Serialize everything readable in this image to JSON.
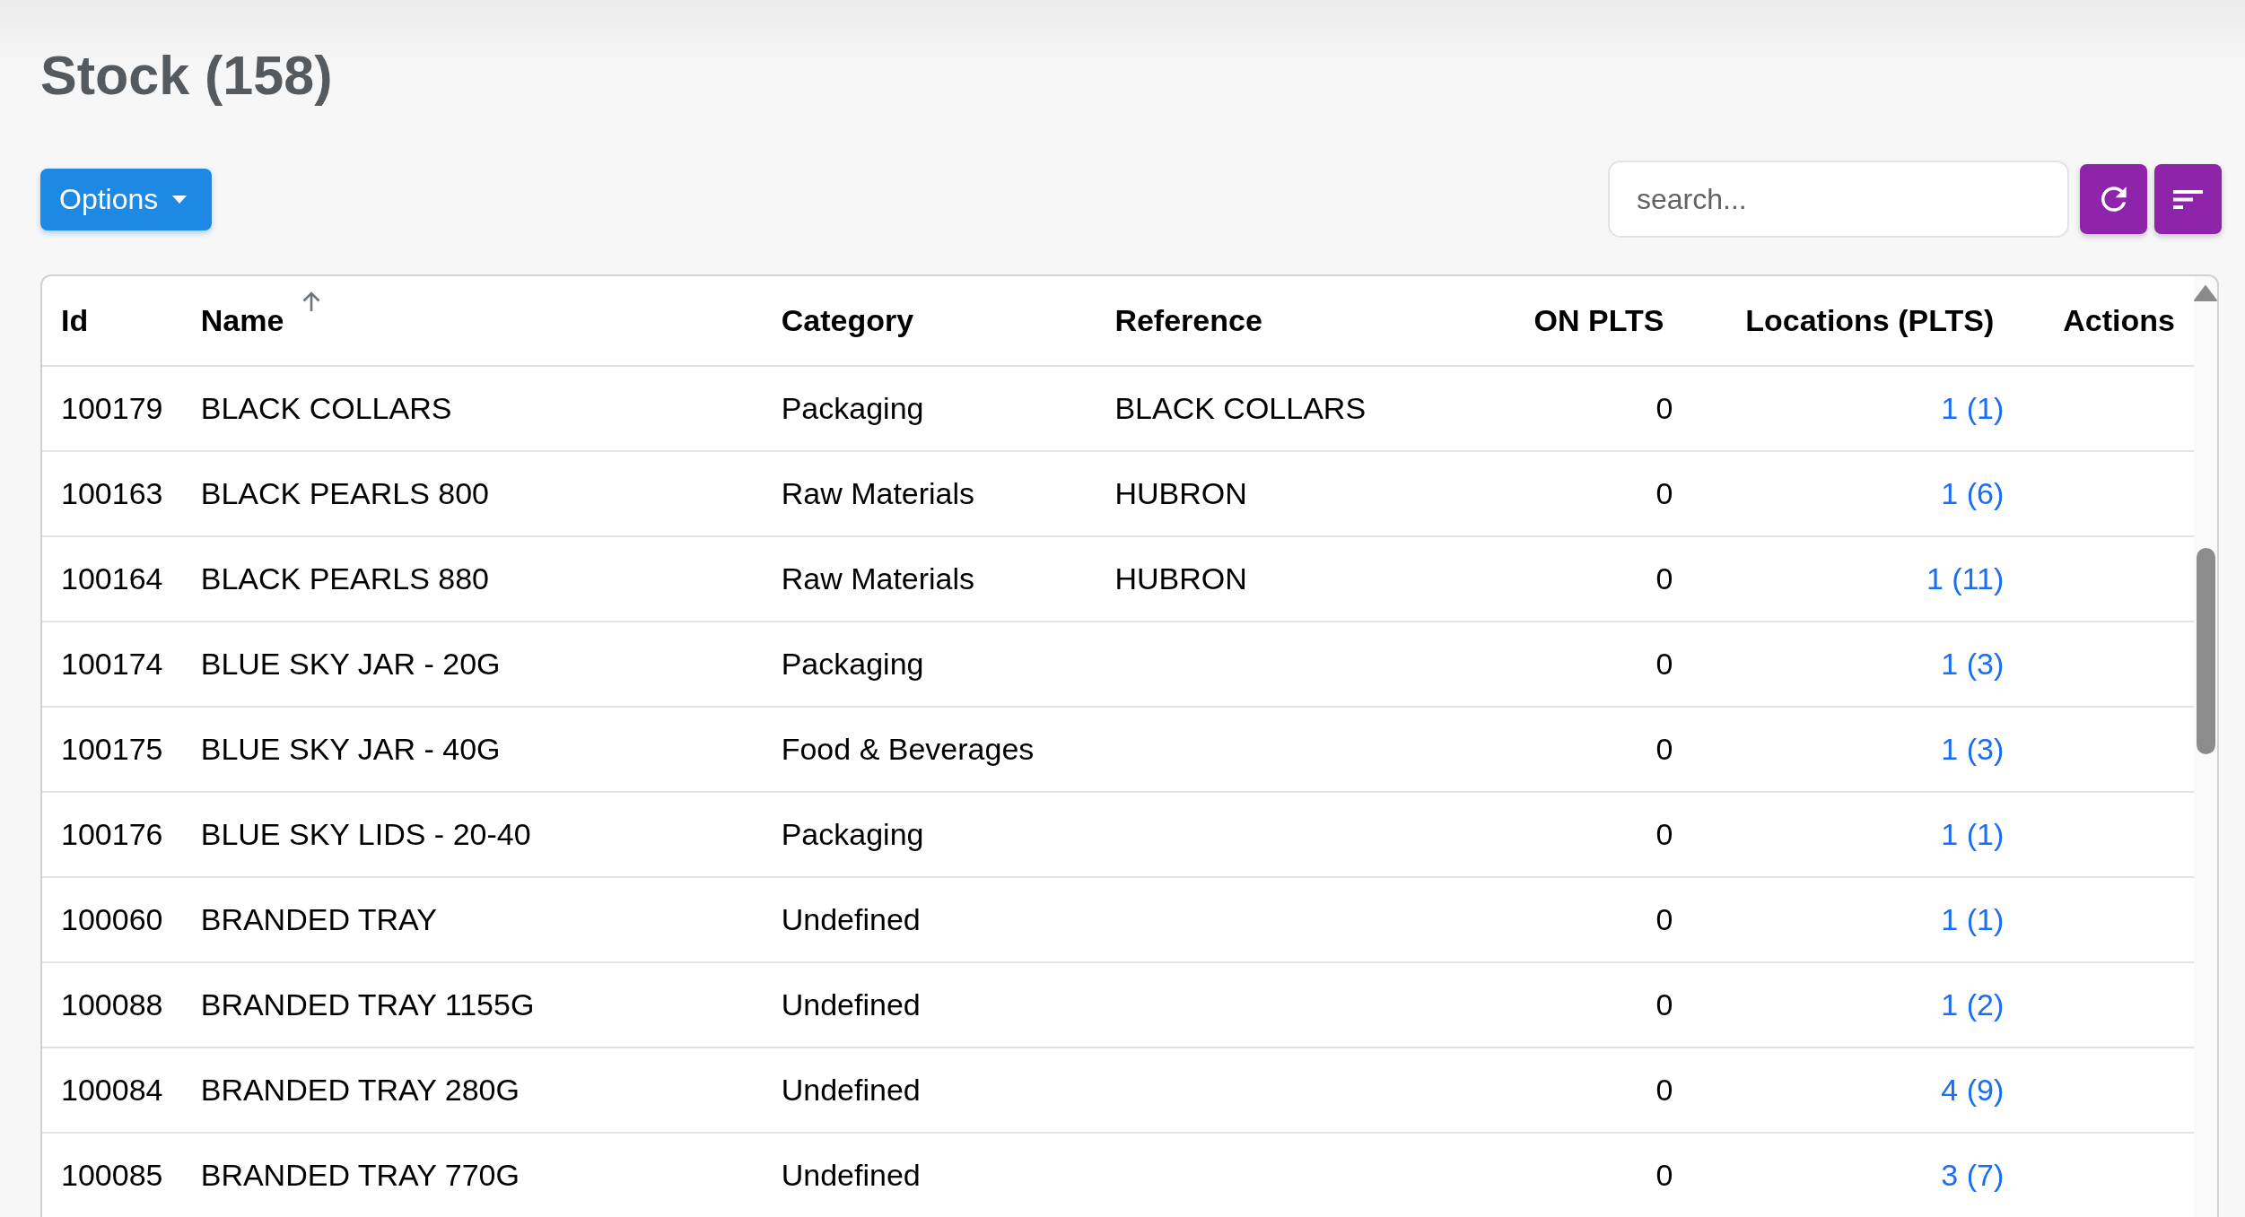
{
  "page": {
    "title": "Stock (158)"
  },
  "toolbar": {
    "options_button": {
      "label": "Options"
    },
    "search": {
      "placeholder": "search..."
    },
    "buttons": [
      {
        "kind": "refresh"
      },
      {
        "kind": "sort"
      }
    ]
  },
  "table": {
    "columns": [
      {
        "label": "Id",
        "kind": "text",
        "sorted": false
      },
      {
        "label": "Name",
        "kind": "text",
        "sorted": true
      },
      {
        "label": "Category",
        "kind": "text",
        "sorted": false
      },
      {
        "label": "Reference",
        "kind": "text",
        "sorted": false
      },
      {
        "label": "ON PLTS",
        "kind": "number",
        "sorted": false
      },
      {
        "label": "Locations (PLTS)",
        "kind": "link",
        "sorted": false
      },
      {
        "label": "Actions",
        "kind": "actions",
        "sorted": false
      }
    ],
    "rows": [
      {
        "id": "100179",
        "name": "BLACK COLLARS",
        "category": "Packaging",
        "reference": "BLACK COLLARS",
        "on_plts": "0",
        "locations": "1 (1)"
      },
      {
        "id": "100163",
        "name": "BLACK PEARLS 800",
        "category": "Raw Materials",
        "reference": "HUBRON",
        "on_plts": "0",
        "locations": "1 (6)"
      },
      {
        "id": "100164",
        "name": "BLACK PEARLS 880",
        "category": "Raw Materials",
        "reference": "HUBRON",
        "on_plts": "0",
        "locations": "1 (11)"
      },
      {
        "id": "100174",
        "name": "BLUE SKY JAR - 20G",
        "category": "Packaging",
        "on_plts": "0",
        "locations": "1 (3)"
      },
      {
        "id": "100175",
        "name": "BLUE SKY JAR - 40G",
        "category": "Food & Beverages",
        "on_plts": "0",
        "locations": "1 (3)"
      },
      {
        "id": "100176",
        "name": "BLUE SKY LIDS - 20-40",
        "category": "Packaging",
        "on_plts": "0",
        "locations": "1 (1)"
      },
      {
        "id": "100060",
        "name": "BRANDED TRAY",
        "category": "Undefined",
        "on_plts": "0",
        "locations": "1 (1)"
      },
      {
        "id": "100088",
        "name": "BRANDED TRAY 1155G",
        "category": "Undefined",
        "on_plts": "0",
        "locations": "1 (2)"
      },
      {
        "id": "100084",
        "name": "BRANDED TRAY 280G",
        "category": "Undefined",
        "on_plts": "0",
        "locations": "4 (9)"
      },
      {
        "id": "100085",
        "name": "BRANDED TRAY 770G",
        "category": "Undefined",
        "on_plts": "0",
        "locations": "3 (7)"
      }
    ]
  }
}
